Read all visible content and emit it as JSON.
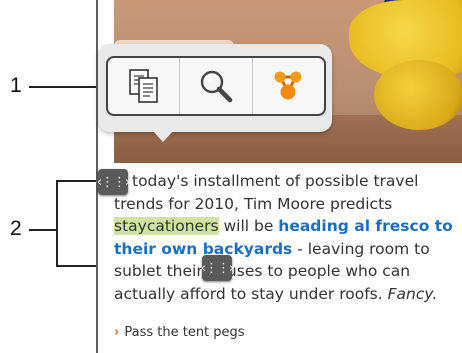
{
  "callouts": {
    "one": "1",
    "two": "2"
  },
  "popup": {
    "items": [
      {
        "name": "copy",
        "icon": "copy-icon"
      },
      {
        "name": "search",
        "icon": "magnifier-icon"
      },
      {
        "name": "share",
        "icon": "share-icon"
      }
    ]
  },
  "article": {
    "part1": "today's installment of possible travel trends for 2010, Tim Moore predicts",
    "highlighted": "staycationers",
    "part2": " will be ",
    "link": "heading al fresco to their own backyards",
    "part3": " - leaving room to sublet their houses to people who can actually afford to stay under roofs. ",
    "italic": "Fancy."
  },
  "handles": {
    "glyph": "‹⋮⋮›"
  },
  "related": {
    "chevron": "›",
    "label": "Pass the tent pegs"
  },
  "colors": {
    "highlight": "#cfe4a0",
    "link": "#1a6fc0",
    "accent": "#e07000"
  }
}
